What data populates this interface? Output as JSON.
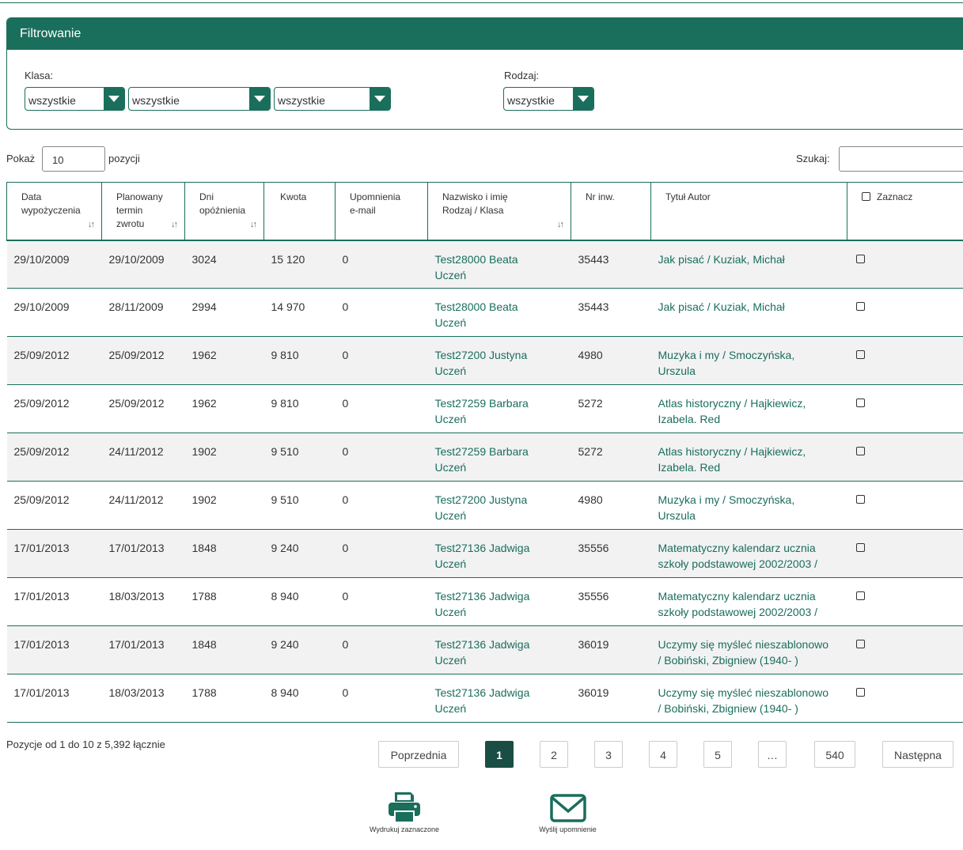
{
  "filter": {
    "title": "Filtrowanie",
    "klasa_label": "Klasa:",
    "rodzaj_label": "Rodzaj:",
    "klasa_select_1": "wszystkie",
    "klasa_select_2": "wszystkie",
    "klasa_select_3": "wszystkie",
    "rodzaj_select": "wszystkie"
  },
  "controls": {
    "show_label": "Pokaż",
    "show_value": "10",
    "show_suffix": "pozycji",
    "search_label": "Szukaj:",
    "search_value": ""
  },
  "table": {
    "headers": {
      "date_line1": "Data",
      "date_line2": "wypożyczenia",
      "planned_line1": "Planowany",
      "planned_line2": "termin",
      "planned_line3": "zwrotu",
      "days_line1": "Dni",
      "days_line2": "opóźnienia",
      "amount": "Kwota",
      "reminders_line1": "Upomnienia",
      "reminders_line2": "e-mail",
      "name_line1": "Nazwisko i imię",
      "name_line2": "Rodzaj / Klasa",
      "inv": "Nr inw.",
      "title": "Tytuł Autor",
      "select": "Zaznacz"
    },
    "rows": [
      {
        "date": "29/10/2009",
        "planned": "29/10/2009",
        "days": "3024",
        "amount": "15 120",
        "reminders": "0",
        "name": "Test28000 Beata",
        "type": "Uczeń",
        "inv": "35443",
        "title_l1": "Jak pisać / Kuziak, Michał",
        "title_l2": ""
      },
      {
        "date": "29/10/2009",
        "planned": "28/11/2009",
        "days": "2994",
        "amount": "14 970",
        "reminders": "0",
        "name": "Test28000 Beata",
        "type": "Uczeń",
        "inv": "35443",
        "title_l1": "Jak pisać / Kuziak, Michał",
        "title_l2": ""
      },
      {
        "date": "25/09/2012",
        "planned": "25/09/2012",
        "days": "1962",
        "amount": "9 810",
        "reminders": "0",
        "name": "Test27200 Justyna",
        "type": "Uczeń",
        "inv": "4980",
        "title_l1": "Muzyka i my / Smoczyńska,",
        "title_l2": "Urszula"
      },
      {
        "date": "25/09/2012",
        "planned": "25/09/2012",
        "days": "1962",
        "amount": "9 810",
        "reminders": "0",
        "name": "Test27259 Barbara",
        "type": "Uczeń",
        "inv": "5272",
        "title_l1": "Atlas historyczny / Hajkiewicz,",
        "title_l2": "Izabela. Red"
      },
      {
        "date": "25/09/2012",
        "planned": "24/11/2012",
        "days": "1902",
        "amount": "9 510",
        "reminders": "0",
        "name": "Test27259 Barbara",
        "type": "Uczeń",
        "inv": "5272",
        "title_l1": "Atlas historyczny / Hajkiewicz,",
        "title_l2": "Izabela. Red"
      },
      {
        "date": "25/09/2012",
        "planned": "24/11/2012",
        "days": "1902",
        "amount": "9 510",
        "reminders": "0",
        "name": "Test27200 Justyna",
        "type": "Uczeń",
        "inv": "4980",
        "title_l1": "Muzyka i my / Smoczyńska,",
        "title_l2": "Urszula"
      },
      {
        "date": "17/01/2013",
        "planned": "17/01/2013",
        "days": "1848",
        "amount": "9 240",
        "reminders": "0",
        "name": "Test27136 Jadwiga",
        "type": "Uczeń",
        "inv": "35556",
        "title_l1": "Matematyczny kalendarz ucznia",
        "title_l2": "szkoły podstawowej 2002/2003 /"
      },
      {
        "date": "17/01/2013",
        "planned": "18/03/2013",
        "days": "1788",
        "amount": "8 940",
        "reminders": "0",
        "name": "Test27136 Jadwiga",
        "type": "Uczeń",
        "inv": "35556",
        "title_l1": "Matematyczny kalendarz ucznia",
        "title_l2": "szkoły podstawowej 2002/2003 /"
      },
      {
        "date": "17/01/2013",
        "planned": "17/01/2013",
        "days": "1848",
        "amount": "9 240",
        "reminders": "0",
        "name": "Test27136 Jadwiga",
        "type": "Uczeń",
        "inv": "36019",
        "title_l1": "Uczymy się myśleć nieszablonowo",
        "title_l2": "/ Bobiński, Zbigniew (1940- )"
      },
      {
        "date": "17/01/2013",
        "planned": "18/03/2013",
        "days": "1788",
        "amount": "8 940",
        "reminders": "0",
        "name": "Test27136 Jadwiga",
        "type": "Uczeń",
        "inv": "36019",
        "title_l1": "Uczymy się myśleć nieszablonowo",
        "title_l2": "/ Bobiński, Zbigniew (1940- )"
      }
    ]
  },
  "pagination": {
    "info": "Pozycje od 1 do 10 z 5,392 łącznie",
    "prev": "Poprzednia",
    "pages": [
      "1",
      "2",
      "3",
      "4",
      "5",
      "…",
      "540"
    ],
    "current": "1",
    "next": "Następna"
  },
  "actions": {
    "print_label": "Wydrukuj zaznaczone",
    "print_icon": "printer-icon",
    "send_label": "Wyślij upomnienie",
    "send_icon": "envelope-icon"
  },
  "colors": {
    "primary": "#1a6e5c",
    "active_page": "#1a4e44",
    "row_alt": "#f2f2f2"
  }
}
